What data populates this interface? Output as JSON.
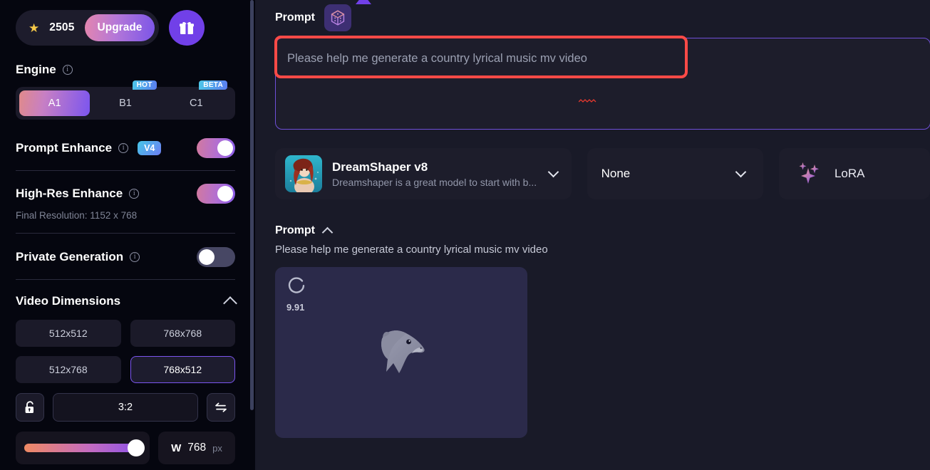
{
  "sidebar": {
    "credits": {
      "icon": "star-icon",
      "value": "2505",
      "upgrade_label": "Upgrade",
      "gift_icon": "gift-icon"
    },
    "engine": {
      "title": "Engine",
      "info_icon": "info-icon",
      "options": [
        {
          "label": "A1",
          "tag": "",
          "active": true
        },
        {
          "label": "B1",
          "tag": "HOT",
          "active": false
        },
        {
          "label": "C1",
          "tag": "BETA",
          "active": false
        }
      ]
    },
    "prompt_enhance": {
      "label": "Prompt Enhance",
      "badge": "V4",
      "state": "on"
    },
    "high_res_enhance": {
      "label": "High-Res Enhance",
      "state": "on",
      "final_resolution": "Final Resolution: 1152 x 768"
    },
    "private_generation": {
      "label": "Private Generation",
      "state": "off"
    },
    "video_dimensions": {
      "title": "Video Dimensions",
      "collapse_icon": "chevron-up-icon",
      "presets": [
        {
          "label": "512x512",
          "selected": false
        },
        {
          "label": "768x768",
          "selected": false
        },
        {
          "label": "512x768",
          "selected": false
        },
        {
          "label": "768x512",
          "selected": true
        }
      ],
      "lock_icon": "unlock-icon",
      "aspect_ratio": "3:2",
      "swap_icon": "swap-icon",
      "width": {
        "label": "W",
        "value": "768",
        "unit": "px",
        "slider_percent": 100
      }
    }
  },
  "main": {
    "prompt_header": {
      "label": "Prompt",
      "dice_icon": "dice-icon"
    },
    "prompt_input": {
      "value": "Please help me generate a country lyrical music mv video",
      "placeholder": "Please help me generate a country lyrical music mv video",
      "misspelled_word": "mv",
      "highlight_color": "#fb4a47",
      "border_color": "#6f4fd8"
    },
    "model_selector": {
      "name": "DreamShaper v8",
      "description": "Dreamshaper is a great model to start with b...",
      "chevron_icon": "chevron-down-icon",
      "thumbnail": "model-thumbnail"
    },
    "style_select": {
      "value": "None",
      "chevron_icon": "chevron-down-icon"
    },
    "lora": {
      "label": "LoRA",
      "icon": "sparkles-icon"
    },
    "result": {
      "header_label": "Prompt",
      "collapse_icon": "chevron-up-icon",
      "prompt_text": "Please help me generate a country lyrical music mv video",
      "progress_value": "9.91",
      "spinner_icon": "loading-spinner-icon",
      "placeholder_icon": "otter-logo-icon"
    }
  }
}
